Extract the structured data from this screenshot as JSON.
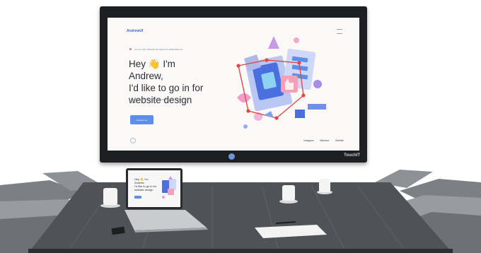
{
  "display": {
    "brand": "TouchIT",
    "website": {
      "logo": "AndrewUI",
      "tagline": "UI/UX AND PREMIUM DESIGN WEBDESIGN",
      "hero_line1": "Hey 👋 I'm Andrew,",
      "hero_line2": "I'd like to go in for",
      "hero_line3": "website design",
      "description": "I create projects that will solve your business tasks and user problems",
      "cta_label": "Contact me",
      "footer_links": [
        "Instagram",
        "Behance",
        "Dribbble"
      ]
    }
  },
  "laptop": {
    "hero_line1": "Hey 👋 I'm Andrew,",
    "hero_line2": "I'd like to go in for",
    "hero_line3": "website design"
  },
  "colors": {
    "accent": "#5e8ee8",
    "table": "#4e5155",
    "chairs": "#8a8d92"
  }
}
